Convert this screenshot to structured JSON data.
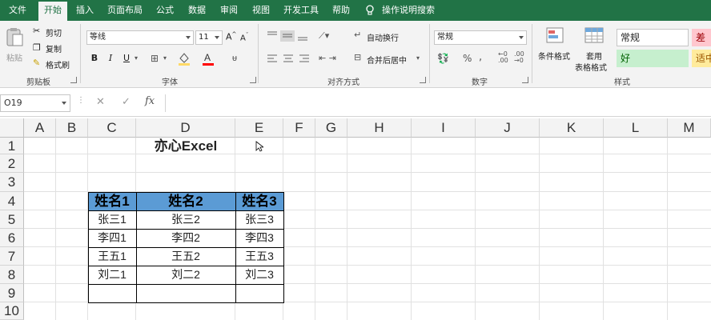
{
  "tabs": [
    "文件",
    "开始",
    "插入",
    "页面布局",
    "公式",
    "数据",
    "审阅",
    "视图",
    "开发工具",
    "帮助",
    "操作说明搜索"
  ],
  "active_tab": "开始",
  "ribbon": {
    "clipboard": {
      "paste": "粘贴",
      "cut": "剪切",
      "copy": "复制",
      "format_painter": "格式刷",
      "label": "剪贴板"
    },
    "font": {
      "font_name": "等线",
      "font_size": "11",
      "bold": "B",
      "italic": "I",
      "underline": "U",
      "label": "字体"
    },
    "alignment": {
      "wrap_text": "自动换行",
      "merge_center": "合并后居中",
      "label": "对齐方式"
    },
    "number": {
      "format": "常规",
      "percent": "%",
      "comma": ",",
      "label": "数字"
    },
    "styles": {
      "conditional_format": "条件格式",
      "table_format_1": "套用",
      "table_format_2": "表格格式",
      "cell_normal": "常规",
      "cell_bad": "差",
      "cell_good": "好",
      "cell_neutral": "适中",
      "label": "样式"
    }
  },
  "formula_bar": {
    "name_box": "O19",
    "fx": "fx",
    "cancel": "✕",
    "enter": "✓",
    "value": ""
  },
  "columns": [
    "A",
    "B",
    "C",
    "D",
    "E",
    "F",
    "G",
    "H",
    "I",
    "J",
    "K",
    "L",
    "M"
  ],
  "rows": [
    "1",
    "2",
    "3",
    "4",
    "5",
    "6",
    "7",
    "8",
    "9",
    "10"
  ],
  "sheet": {
    "title": "亦心Excel",
    "headers": [
      "姓名1",
      "姓名2",
      "姓名3"
    ],
    "data": [
      [
        "张三1",
        "张三2",
        "张三3"
      ],
      [
        "李四1",
        "李四2",
        "李四3"
      ],
      [
        "王五1",
        "王五2",
        "王五3"
      ],
      [
        "刘二1",
        "刘二2",
        "刘二3"
      ],
      [
        "",
        "",
        ""
      ]
    ]
  },
  "colors": {
    "brand": "#217346",
    "header_fill": "#5b9bd5",
    "good_fill": "#c6efce",
    "bad_fill": "#ffc7ce",
    "neutral_fill": "#ffeb9c"
  }
}
